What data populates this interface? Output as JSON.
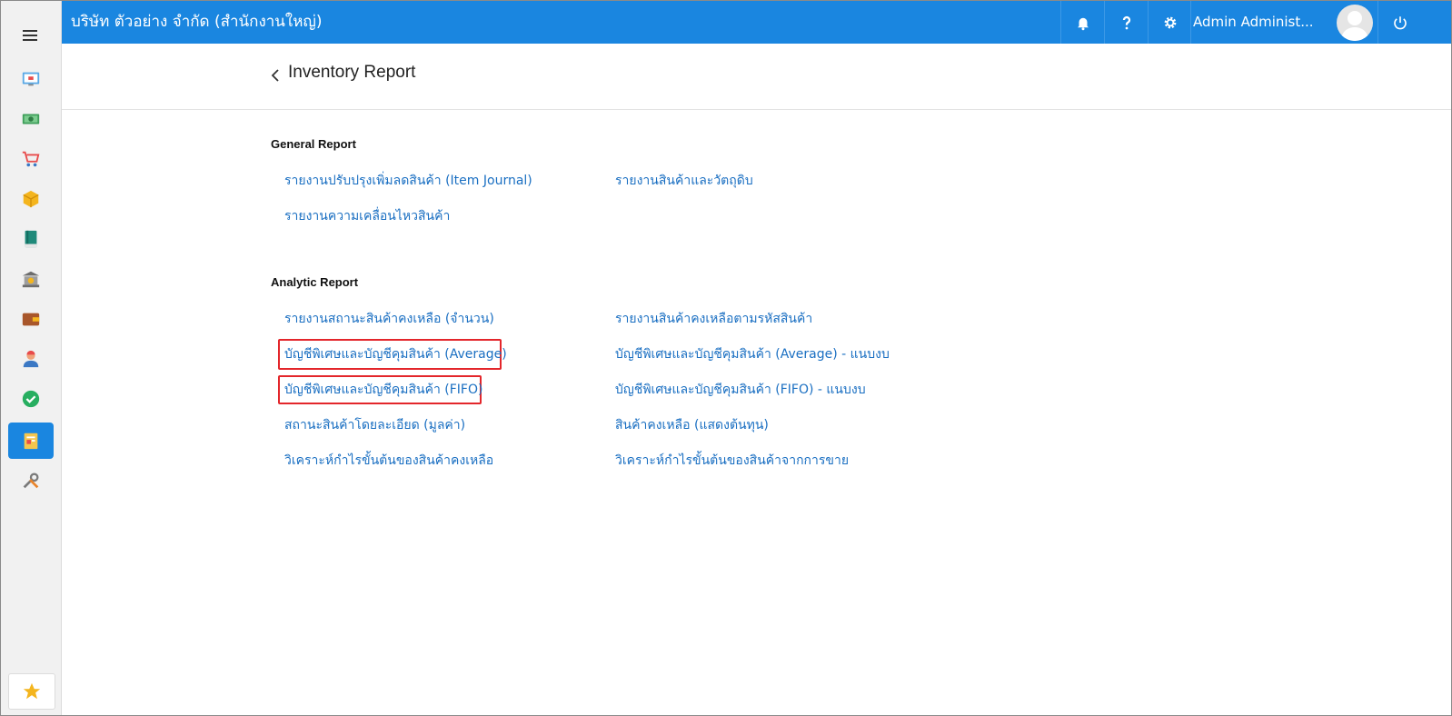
{
  "header": {
    "company": "บริษัท ตัวอย่าง จำกัด (สำนักงานใหญ่)",
    "user": "Admin Administ..."
  },
  "page": {
    "title": "Inventory Report"
  },
  "general": {
    "title": "General Report",
    "links": [
      "รายงานปรับปรุงเพิ่มลดสินค้า (Item Journal)",
      "รายงานสินค้าและวัตถุดิบ",
      "รายงานความเคลื่อนไหวสินค้า"
    ]
  },
  "analytic": {
    "title": "Analytic Report",
    "links": [
      "รายงานสถานะสินค้าคงเหลือ (จำนวน)",
      "รายงานสินค้าคงเหลือตามรหัสสินค้า",
      "บัญชีพิเศษและบัญชีคุมสินค้า (Average)",
      "บัญชีพิเศษและบัญชีคุมสินค้า (Average) - แนบงบ",
      "บัญชีพิเศษและบัญชีคุมสินค้า (FIFO)",
      "บัญชีพิเศษและบัญชีคุมสินค้า (FIFO) - แนบงบ",
      "สถานะสินค้าโดยละเอียด (มูลค่า)",
      "สินค้าคงเหลือ (แสดงต้นทุน)",
      "วิเคราะห์กำไรขั้นต้นของสินค้าคงเหลือ",
      "วิเคราะห์กำไรขั้นต้นของสินค้าจากการขาย"
    ]
  },
  "colors": {
    "brand": "#1a86e0",
    "link": "#1a6fc2",
    "highlight": "#e3262b"
  }
}
